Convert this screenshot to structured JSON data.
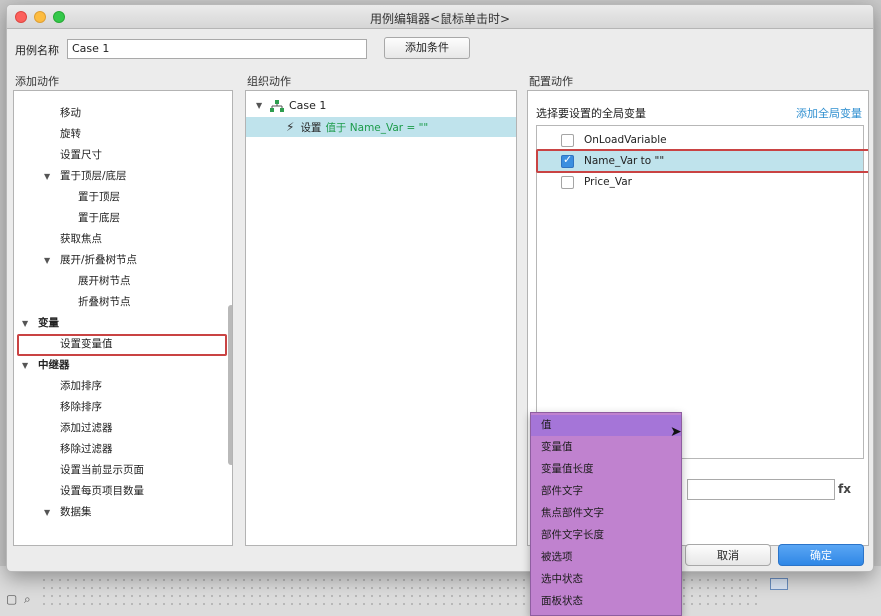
{
  "window": {
    "title": "用例编辑器<鼠标单击时>"
  },
  "case_name": {
    "label": "用例名称",
    "value": "Case 1"
  },
  "add_condition_label": "添加条件",
  "sections": {
    "add_action": "添加动作",
    "organize_action": "组织动作",
    "configure_action": "配置动作"
  },
  "action_tree": [
    {
      "label": "移动",
      "indent": 1,
      "bold": false,
      "arrow": false
    },
    {
      "label": "旋转",
      "indent": 1,
      "bold": false,
      "arrow": false
    },
    {
      "label": "设置尺寸",
      "indent": 1,
      "bold": false,
      "arrow": false
    },
    {
      "label": "置于顶层/底层",
      "indent": 1,
      "bold": false,
      "arrow": true
    },
    {
      "label": "置于顶层",
      "indent": 2,
      "bold": false,
      "arrow": false
    },
    {
      "label": "置于底层",
      "indent": 2,
      "bold": false,
      "arrow": false
    },
    {
      "label": "获取焦点",
      "indent": 1,
      "bold": false,
      "arrow": false
    },
    {
      "label": "展开/折叠树节点",
      "indent": 1,
      "bold": false,
      "arrow": true
    },
    {
      "label": "展开树节点",
      "indent": 2,
      "bold": false,
      "arrow": false
    },
    {
      "label": "折叠树节点",
      "indent": 2,
      "bold": false,
      "arrow": false
    },
    {
      "label": "变量",
      "indent": 0,
      "bold": true,
      "arrow": true
    },
    {
      "label": "设置变量值",
      "indent": 1,
      "bold": false,
      "arrow": false
    },
    {
      "label": "中继器",
      "indent": 0,
      "bold": true,
      "arrow": true
    },
    {
      "label": "添加排序",
      "indent": 1,
      "bold": false,
      "arrow": false
    },
    {
      "label": "移除排序",
      "indent": 1,
      "bold": false,
      "arrow": false
    },
    {
      "label": "添加过滤器",
      "indent": 1,
      "bold": false,
      "arrow": false
    },
    {
      "label": "移除过滤器",
      "indent": 1,
      "bold": false,
      "arrow": false
    },
    {
      "label": "设置当前显示页面",
      "indent": 1,
      "bold": false,
      "arrow": false
    },
    {
      "label": "设置每页项目数量",
      "indent": 1,
      "bold": false,
      "arrow": false
    },
    {
      "label": "数据集",
      "indent": 1,
      "bold": false,
      "arrow": true
    }
  ],
  "organize": {
    "case_node": "Case 1",
    "action_prefix": "设置",
    "action_detail": "值于 Name_Var = \"\""
  },
  "configure": {
    "prompt": "选择要设置的全局变量",
    "add_global_link": "添加全局变量",
    "variables": [
      {
        "name": "OnLoadVariable",
        "checked": false
      },
      {
        "name": "Name_Var to \"\"",
        "checked": true
      },
      {
        "name": "Price_Var",
        "checked": false
      }
    ],
    "fx_label": "fx"
  },
  "buttons": {
    "cancel": "取消",
    "ok": "确定"
  },
  "dropdown": {
    "items": [
      "值",
      "变量值",
      "变量值长度",
      "部件文字",
      "焦点部件文字",
      "部件文字长度",
      "被选项",
      "选中状态",
      "面板状态"
    ],
    "active_index": 0
  }
}
